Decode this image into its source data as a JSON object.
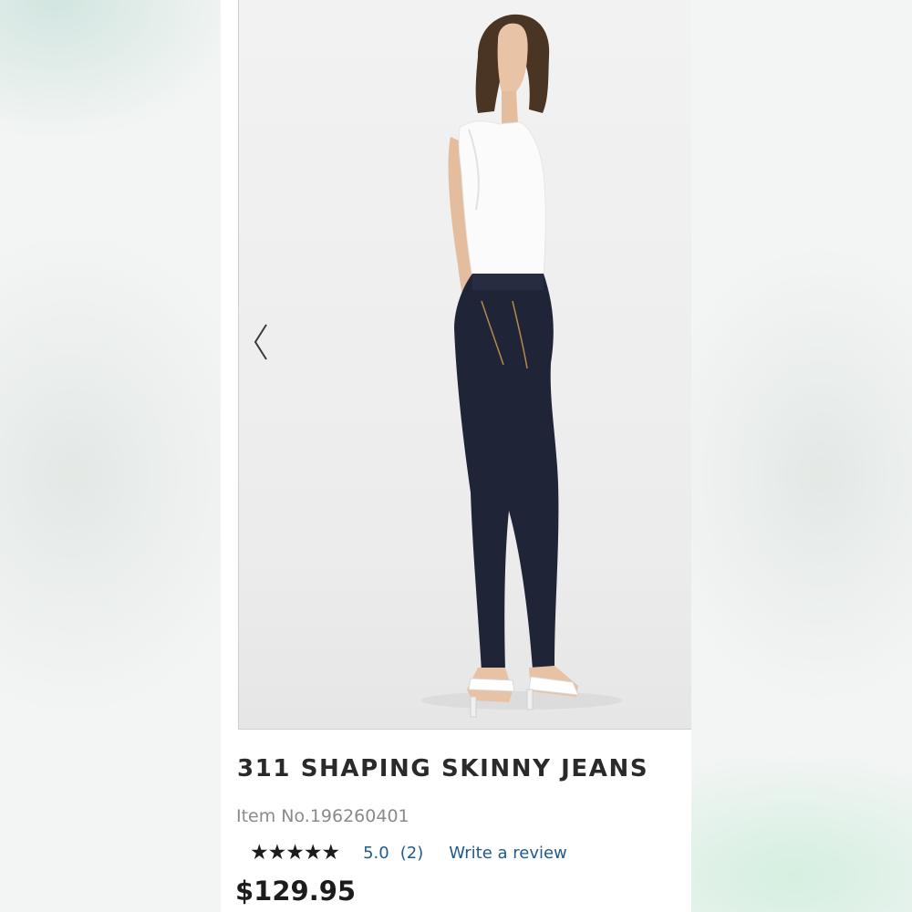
{
  "product": {
    "image_alt": "Model wearing dark indigo skinny jeans, white tank top and white heeled sandals",
    "title": "311 SHAPING SKINNY JEANS",
    "item_number": "Item No.196260401",
    "rating": {
      "stars": "★★★★★",
      "score": "5.0",
      "count": "(2)",
      "value": 5.0,
      "max": 5
    },
    "write_review_label": "Write a review",
    "price": "$129.95"
  },
  "gallery": {
    "prev_icon": "chevron-left-icon"
  },
  "colors": {
    "link": "#1f5a8f",
    "title": "#2a2a2a",
    "muted": "#8a8a8a",
    "denim": "#1f2437"
  }
}
